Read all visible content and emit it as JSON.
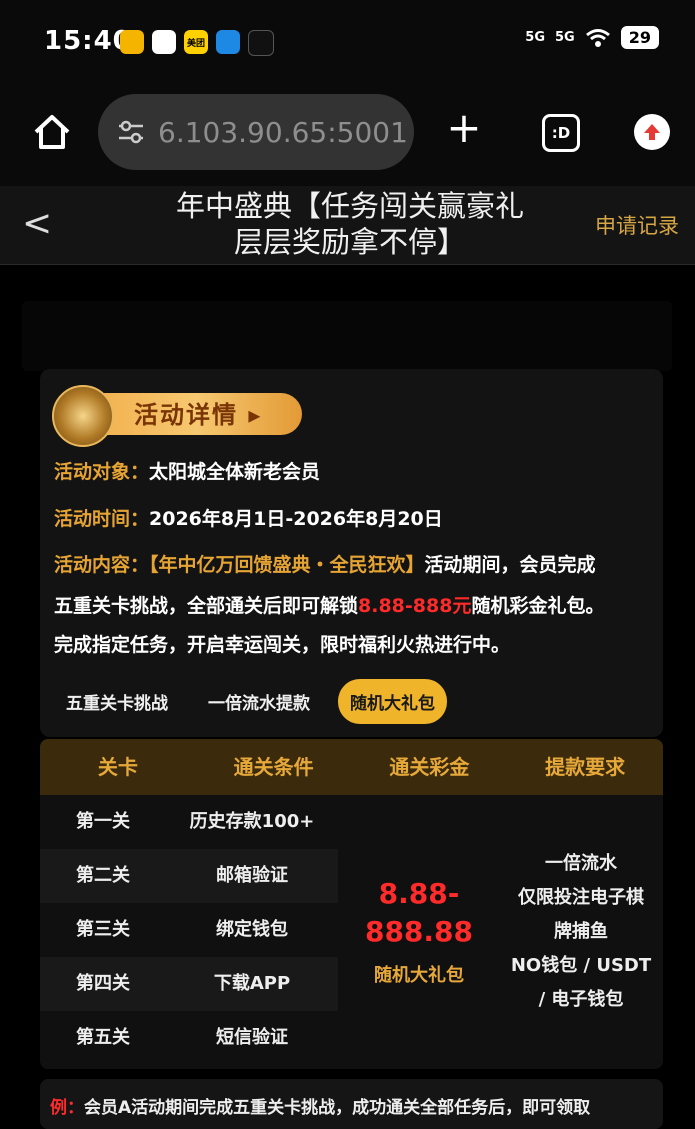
{
  "status_bar": {
    "time": "15:40",
    "app_icons": [
      "美团"
    ],
    "signal1": "5G",
    "signal2": "5G",
    "battery": "29"
  },
  "browser": {
    "url": "6.103.90.65:5001",
    "plus": "+",
    "tab_label": ":D"
  },
  "header": {
    "back": "<",
    "title_line1": "年中盛典【任务闯关赢豪礼",
    "title_line2": "层层奖励拿不停】",
    "apply_record": "申请记录"
  },
  "details": {
    "badge": "活动详情 ▸",
    "target_label": "活动对象：",
    "target_value": "太阳城全体新老会员",
    "time_label": "活动时间：",
    "time_value": "2026年8月1日-2026年8月20日",
    "content_label": "活动内容：",
    "content_highlight": "【年中亿万回馈盛典・全民狂欢】",
    "content_text1": "活动期间，会员完成",
    "content_text2a": "五重关卡挑战，全部通关后即可解锁",
    "content_amount": "8.88-888元",
    "content_text2b": "随机彩金礼包。",
    "content_text3": "完成指定任务，开启幸运闯关，限时福利火热进行中。"
  },
  "tabs": [
    "五重关卡挑战",
    "一倍流水提款",
    "随机大礼包"
  ],
  "table": {
    "headers": [
      "关卡",
      "通关条件",
      "通关彩金",
      "提款要求"
    ],
    "rows": [
      {
        "level": "第一关",
        "condition": "历史存款100+"
      },
      {
        "level": "第二关",
        "condition": "邮箱验证"
      },
      {
        "level": "第三关",
        "condition": "绑定钱包"
      },
      {
        "level": "第四关",
        "condition": "下载APP"
      },
      {
        "level": "第五关",
        "condition": "短信验证"
      }
    ],
    "prize_line1": "8.88-",
    "prize_line2": "888.88",
    "prize_sub": "随机大礼包",
    "req_lines": [
      "一倍流水",
      "仅限投注电子棋",
      "牌捕鱼",
      "NO钱包 / USDT",
      "/ 电子钱包"
    ]
  },
  "example": {
    "label": "例：",
    "text": "会员A活动期间完成五重关卡挑战，成功通关全部任务后，即可领取"
  },
  "colors": {
    "accent": "#e5a433",
    "red": "#ff2a2a",
    "active_tab": "#f0b42a"
  }
}
